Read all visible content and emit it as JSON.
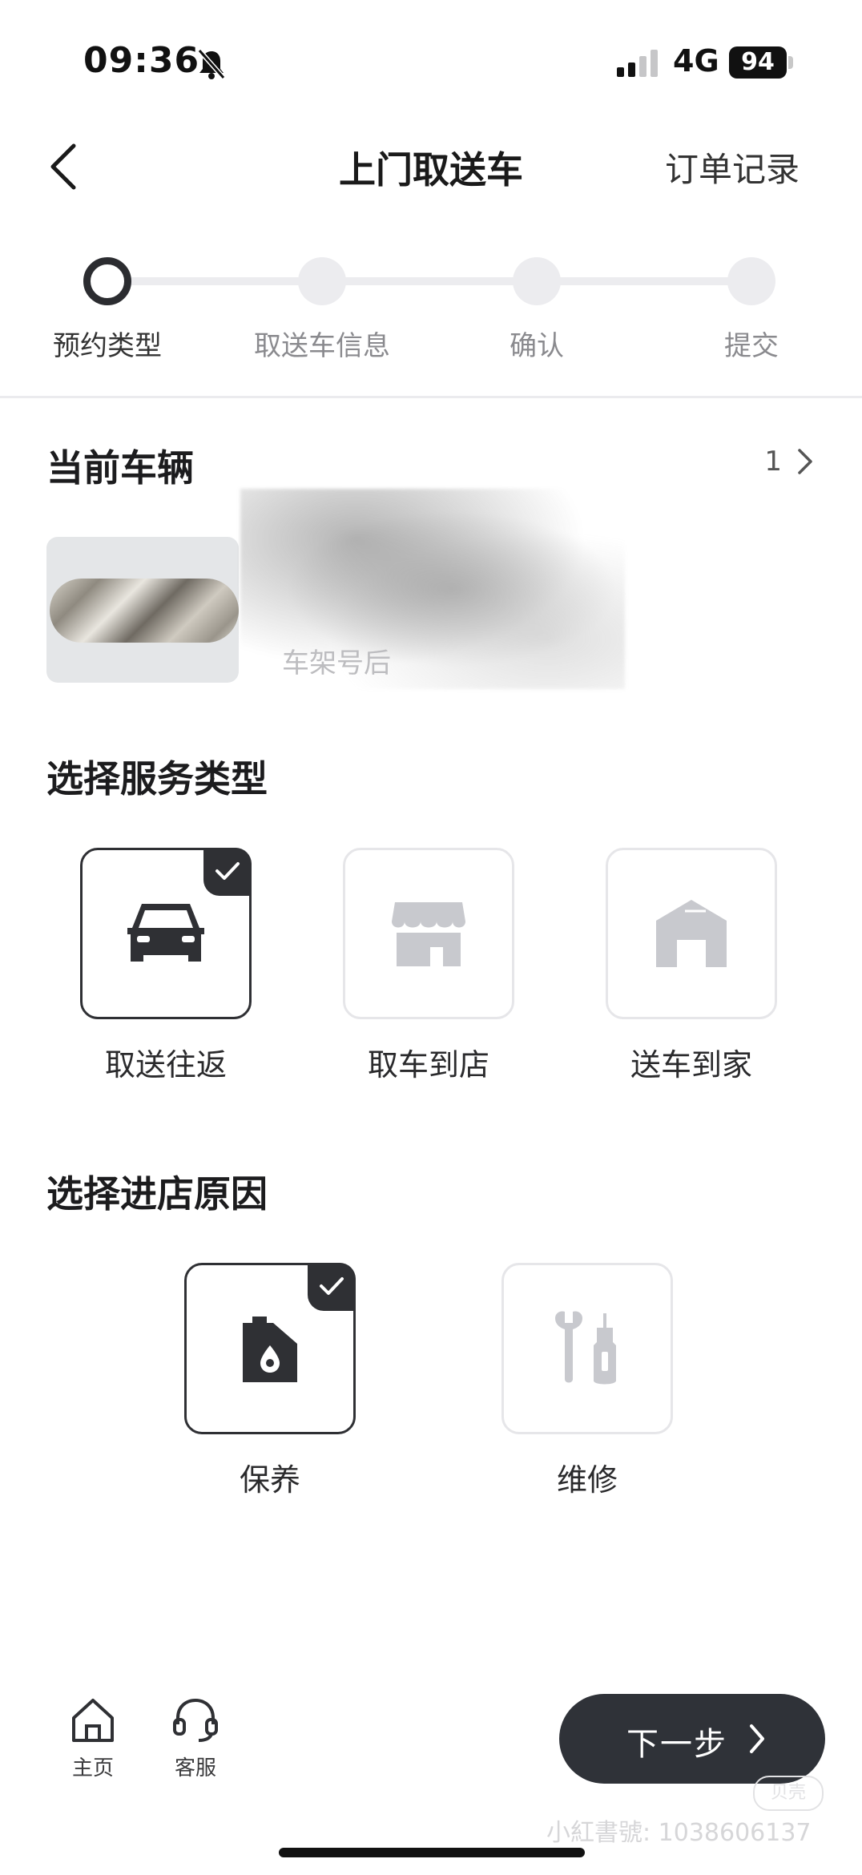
{
  "status_bar": {
    "time": "09:36",
    "network": "4G",
    "battery": "94",
    "icons": [
      "bell-muted-icon",
      "signal-icon",
      "battery-icon"
    ]
  },
  "nav": {
    "title": "上门取送车",
    "right_action": "订单记录",
    "back_icon": "back-chevron-icon"
  },
  "stepper": {
    "steps": [
      {
        "label": "预约类型",
        "active": true
      },
      {
        "label": "取送车信息",
        "active": false
      },
      {
        "label": "确认",
        "active": false
      },
      {
        "label": "提交",
        "active": false
      }
    ]
  },
  "vehicle": {
    "title": "当前车辆",
    "count": "1",
    "vin_label": "车架号后"
  },
  "service_type": {
    "title": "选择服务类型",
    "options": [
      {
        "label": "取送往返",
        "icon": "car-icon",
        "selected": true
      },
      {
        "label": "取车到店",
        "icon": "store-icon",
        "selected": false
      },
      {
        "label": "送车到家",
        "icon": "home-garage-icon",
        "selected": false
      }
    ]
  },
  "visit_reason": {
    "title": "选择进店原因",
    "options": [
      {
        "label": "保养",
        "icon": "oil-can-icon",
        "selected": true
      },
      {
        "label": "维修",
        "icon": "repair-tools-icon",
        "selected": false
      }
    ]
  },
  "bottom_bar": {
    "tabs": [
      {
        "label": "主页",
        "icon": "home-icon"
      },
      {
        "label": "客服",
        "icon": "headset-icon"
      }
    ],
    "next_label": "下一步"
  },
  "watermark": {
    "text": "小紅書號: 1038606137",
    "badge": "贝壳"
  },
  "colors": {
    "primary_dark": "#2f3034",
    "muted": "#c8c9ce",
    "border": "#e6e6e9"
  }
}
